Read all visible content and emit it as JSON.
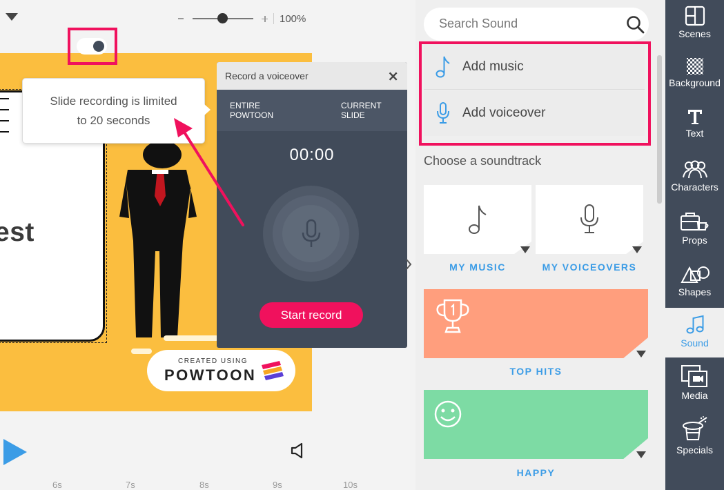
{
  "zoom": {
    "percent": "100%"
  },
  "tooltip": {
    "line1": "Slide recording is limited",
    "line2": "to 20 seconds"
  },
  "slide": {
    "text": "est",
    "badge_small": "CREATED USING",
    "badge_brand": "POWTOON"
  },
  "voiceover_panel": {
    "title": "Record a voiceover",
    "close": "×",
    "option_left_1": "ENTIRE",
    "option_left_2": "POWTOON",
    "option_right_1": "CURRENT",
    "option_right_2": "SLIDE",
    "toggle_selected": "CURRENT SLIDE",
    "timer": "00:00",
    "start_label": "Start record"
  },
  "timeline": {
    "ticks": [
      "6s",
      "7s",
      "8s",
      "9s",
      "10s"
    ]
  },
  "sound_panel": {
    "search_placeholder": "Search Sound",
    "add_music": "Add music",
    "add_voiceover": "Add voiceover",
    "choose_label": "Choose a soundtrack",
    "categories": [
      {
        "label": "MY MUSIC",
        "icon": "music-note-icon"
      },
      {
        "label": "MY VOICEOVERS",
        "icon": "microphone-icon"
      },
      {
        "label": "TOP HITS",
        "icon": "trophy-icon",
        "color": "#ff9e7d"
      },
      {
        "label": "HAPPY",
        "icon": "smiley-icon",
        "color": "#7ddba4"
      }
    ]
  },
  "toolbar": {
    "items": [
      {
        "label": "Scenes",
        "icon": "scenes-icon"
      },
      {
        "label": "Background",
        "icon": "background-icon"
      },
      {
        "label": "Text",
        "icon": "text-icon"
      },
      {
        "label": "Characters",
        "icon": "characters-icon"
      },
      {
        "label": "Props",
        "icon": "props-icon"
      },
      {
        "label": "Shapes",
        "icon": "shapes-icon"
      },
      {
        "label": "Sound",
        "icon": "sound-icon",
        "active": true
      },
      {
        "label": "Media",
        "icon": "media-icon"
      },
      {
        "label": "Specials",
        "icon": "specials-icon"
      }
    ]
  },
  "colors": {
    "accent_blue": "#3b9ce6",
    "highlight_pink": "#f0115d",
    "panel_dark": "#414b5a",
    "slide_yellow": "#fbbe3f"
  }
}
